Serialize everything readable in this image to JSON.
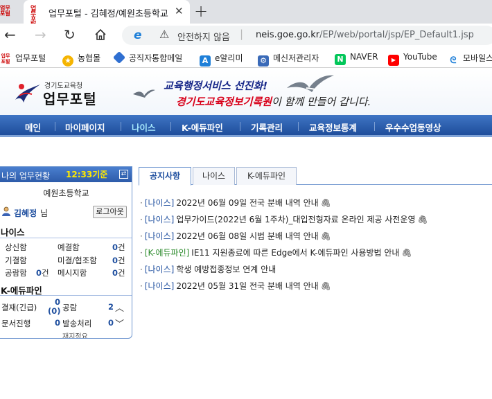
{
  "browser": {
    "tab_title": "업무포털 - 김혜정/예원초등학교",
    "tab_favicon": "업무",
    "address": {
      "security": "안전하지 않음",
      "host": "neis.goe.go.kr",
      "path": "/EP/web/portal/jsp/EP_Default1.jsp"
    },
    "bookmarks": [
      {
        "label": "업무포털",
        "icon": "neis-icon"
      },
      {
        "label": "농협몰",
        "icon": "nh-icon"
      },
      {
        "label": "공직자통합메일",
        "icon": "mail-icon"
      },
      {
        "label": "e알리미",
        "icon": "ealimi-icon"
      },
      {
        "label": "메신저관리자",
        "icon": "messenger-icon"
      },
      {
        "label": "NAVER",
        "icon": "naver-icon"
      },
      {
        "label": "YouTube",
        "icon": "youtube-icon"
      },
      {
        "label": "모바일스",
        "icon": "mobile-icon"
      }
    ]
  },
  "header": {
    "logo_sub": "경기도교육청",
    "logo_main": "업무포털",
    "slogan1": "교육행정서비스 선진화!",
    "slogan2_red": "경기도교육정보기록원",
    "slogan2_rest": "이 함께 만들어 갑니다."
  },
  "gnb": [
    "메인",
    "마이페이지",
    "나이스",
    "K-에듀파인",
    "기록관리",
    "교육정보통계",
    "우수수업동영상"
  ],
  "panel": {
    "title": "나의 업무현황",
    "time": "12:33기준",
    "school": "예원초등학교",
    "user_name": "김혜정",
    "user_suffix": "님",
    "logout": "로그아웃",
    "neis_title": "나이스",
    "neis_rows": [
      {
        "label": "상신함",
        "val": "",
        "label2": "예결함",
        "val2": "0",
        "unit2": "건"
      },
      {
        "label": "기결함",
        "val": "",
        "label2": "미결/협조함",
        "val2": "0",
        "unit2": "건"
      },
      {
        "label": "공람함",
        "val": "0",
        "unit": "건",
        "label2": "메시지함",
        "val2": "0",
        "unit2": "건"
      }
    ],
    "edufine_title": "K-에듀파인",
    "edufine_rows": [
      {
        "label": "결재(긴급)",
        "val": "0",
        "val_sub": "(0)",
        "label2": "공람",
        "val2": "2"
      },
      {
        "label": "문서진행",
        "val": "0",
        "label2": "발송처리",
        "val2": "0"
      }
    ],
    "edufine_partial": "재지정요"
  },
  "tabs": [
    "공지사항",
    "나이스",
    "K-에듀파인"
  ],
  "notices": [
    {
      "cat": "[나이스]",
      "title": "2022년 06월 09일 전국 분배 내역 안내",
      "attach": true,
      "green": false
    },
    {
      "cat": "[나이스]",
      "title": "업무가이드(2022년 6월 1주차)_대입전형자료 온라인 제공 사전운영",
      "attach": true,
      "green": false
    },
    {
      "cat": "[나이스]",
      "title": "2022년 06월 08일 시범 분배 내역 안내",
      "attach": true,
      "green": false
    },
    {
      "cat": "[K-에듀파인]",
      "title": "IE11 지원종료에 따른 Edge에서 K-에듀파인 사용방법 안내",
      "attach": true,
      "green": true
    },
    {
      "cat": "[나이스]",
      "title": "학생 예방접종정보 연계 안내",
      "attach": false,
      "green": false
    },
    {
      "cat": "[나이스]",
      "title": "2022년 05월 31일 전국 분배 내역 안내",
      "attach": true,
      "green": false
    }
  ]
}
